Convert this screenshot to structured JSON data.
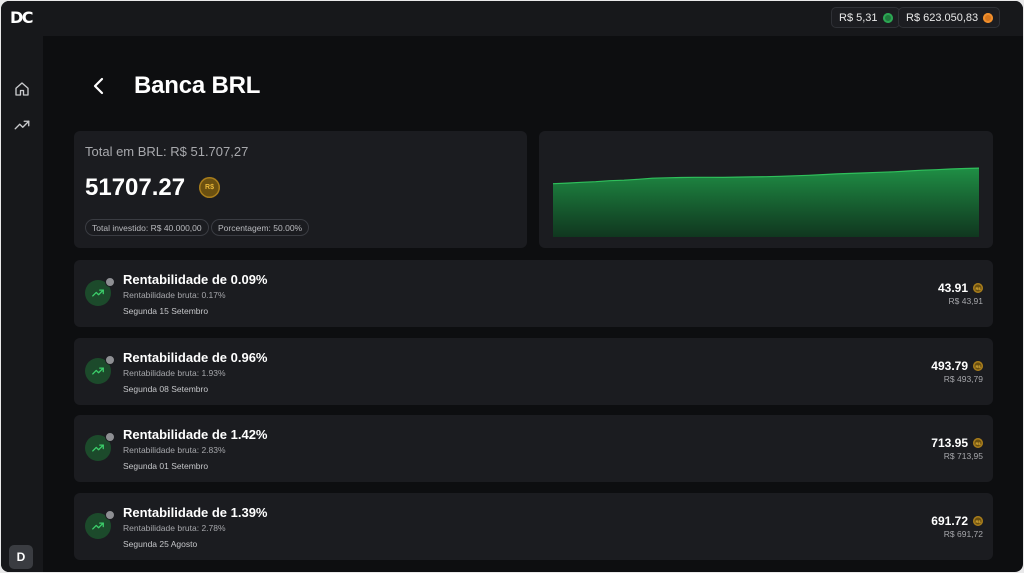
{
  "app": {
    "logo": "DC",
    "user_initial": "D"
  },
  "topbar": {
    "balance_brl": "R$ 5,31",
    "balance_btc": "R$ 623.050,83"
  },
  "page": {
    "title": "Banca BRL"
  },
  "summary": {
    "total_label": "Total em BRL: R$ 51.707,27",
    "value": "51707.27",
    "coin_label": "R$",
    "invested": "Total investido: R$ 40.000,00",
    "percentage": "Porcentagem: 50.00%"
  },
  "chart_data": {
    "type": "area",
    "values": [
      40,
      40.4,
      41,
      41.5,
      42.2,
      42.6,
      43.3,
      44.1,
      44.4,
      44.6,
      44.8,
      44.8,
      44.7,
      44.9,
      45.1,
      45.2,
      45.5,
      45.9,
      46.3,
      46.8,
      47.3,
      47.7,
      48.1,
      48.5,
      48.9,
      49.5,
      50.1,
      50.5,
      51.0,
      51.4,
      51.7
    ],
    "color": "#22a04b",
    "title": "",
    "xlabel": "",
    "ylabel": "",
    "grid": false
  },
  "rows": [
    {
      "title": "Rentabilidade de 0.09%",
      "gross": "Rentabilidade bruta: 0.17%",
      "date": "Segunda 15 Setembro",
      "amount": "43.91",
      "amount_brl": "R$ 43,91"
    },
    {
      "title": "Rentabilidade de 0.96%",
      "gross": "Rentabilidade bruta: 1.93%",
      "date": "Segunda 08 Setembro",
      "amount": "493.79",
      "amount_brl": "R$ 493,79"
    },
    {
      "title": "Rentabilidade de 1.42%",
      "gross": "Rentabilidade bruta: 2.83%",
      "date": "Segunda 01 Setembro",
      "amount": "713.95",
      "amount_brl": "R$ 713,95"
    },
    {
      "title": "Rentabilidade de 1.39%",
      "gross": "Rentabilidade bruta: 2.78%",
      "date": "Segunda 25 Agosto",
      "amount": "691.72",
      "amount_brl": "R$ 691,72"
    }
  ]
}
